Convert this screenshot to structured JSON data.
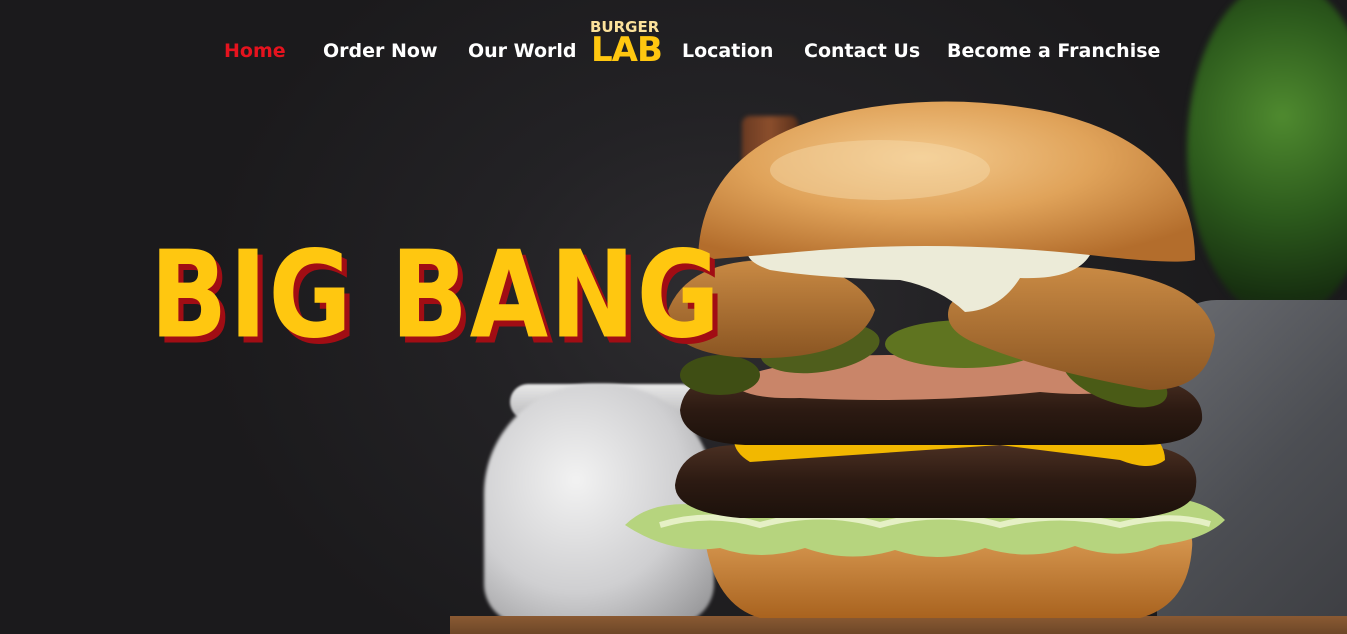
{
  "nav": {
    "items": [
      {
        "label": "Home",
        "active": true
      },
      {
        "label": "Order Now",
        "active": false
      },
      {
        "label": "Our World",
        "active": false
      },
      {
        "label": "Location",
        "active": false
      },
      {
        "label": "Contact Us",
        "active": false
      },
      {
        "label": "Become a Franchise",
        "active": false
      }
    ],
    "active_color": "#e5131e",
    "text_color": "#ffffff"
  },
  "logo": {
    "line1": "BURGER",
    "line2": "LAB"
  },
  "hero": {
    "headline": "BIG BANG",
    "headline_color": "#ffc710",
    "headline_shadow_color": "#a10d14",
    "image_subject": "burger-photo"
  }
}
